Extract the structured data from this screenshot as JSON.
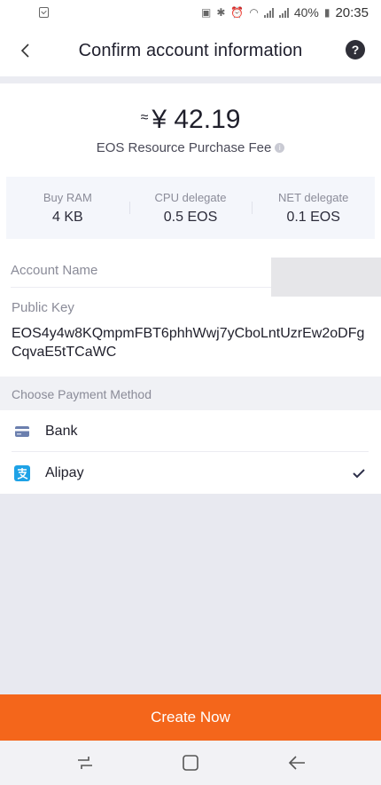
{
  "status_bar": {
    "battery": "40%",
    "time": "20:35"
  },
  "header": {
    "title": "Confirm account information",
    "back_icon": "chevron-left-icon",
    "help_icon": "question-circle-icon",
    "help_symbol": "?"
  },
  "fee": {
    "approx": "≈",
    "amount": "¥ 42.19",
    "label": "EOS Resource Purchase Fee",
    "info_symbol": "i"
  },
  "resources": [
    {
      "label": "Buy RAM",
      "value": "4 KB"
    },
    {
      "label": "CPU delegate",
      "value": "0.5 EOS"
    },
    {
      "label": "NET delegate",
      "value": "0.1 EOS"
    }
  ],
  "account": {
    "name_label": "Account Name",
    "public_key_label": "Public Key",
    "public_key": "EOS4y4w8KQmpmFBT6phhWwj7yCboLntUzrEw2oDFgCqvaE5tTCaWC"
  },
  "payment": {
    "header": "Choose Payment Method",
    "methods": [
      {
        "label": "Bank",
        "icon": "bank-card-icon",
        "selected": false,
        "color": "#6b7fae"
      },
      {
        "label": "Alipay",
        "icon": "alipay-icon",
        "selected": true,
        "color": "#1ea2e6"
      }
    ]
  },
  "actions": {
    "create_label": "Create Now",
    "create_color": "#f4661b"
  }
}
